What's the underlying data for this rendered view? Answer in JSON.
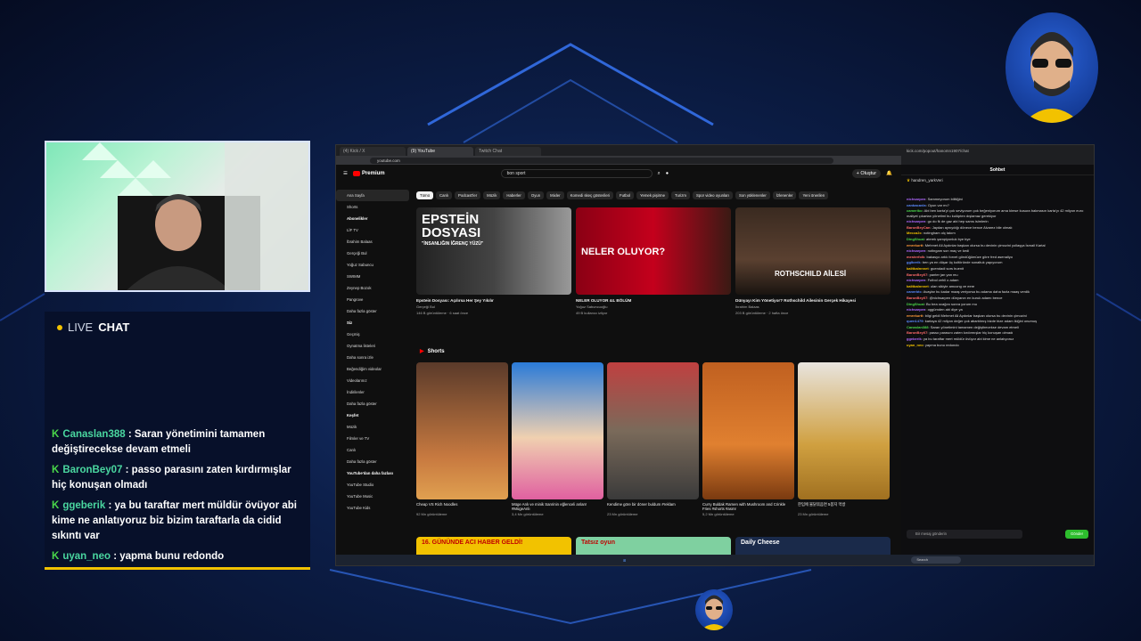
{
  "overlay": {
    "live_label": "LIVE",
    "chat_label": "CHAT",
    "messages": [
      {
        "user": "Canaslan388",
        "text": "Saran yönetimini tamamen değiştirecekse devam etmeli"
      },
      {
        "user": "BaronBey07",
        "text": "passo parasını zaten kırdırmışlar hiç konuşan olmadı"
      },
      {
        "user": "ggeberik",
        "text": "ya bu taraftar mert müldür övüyor abi kime ne anlatıyoruz biz bizim taraftarla da cidid sıkıntı var"
      },
      {
        "user": "uyan_neo",
        "text": "yapma bunu redondo"
      }
    ]
  },
  "browser": {
    "tabs": [
      "(4) Kick / X",
      "(9) YouTube",
      "Twitch Chat"
    ],
    "url": "youtube.com"
  },
  "youtube": {
    "logo": "Premium",
    "search": "bon sport",
    "create": "+ Oluştur",
    "sidebar": [
      "Ana Sayfa",
      "Shorts",
      "Abonelikler",
      "LİF TV",
      "İbrahim Balaas",
      "Gerçeği Bul",
      "Yoğuz Sabuncu",
      "SWIMM",
      "Zeynep Bozok",
      "Pangrove",
      "Daha fazla göster",
      "Siz",
      "Geçmiş",
      "Oynatma listeleri",
      "Daha sonra izle",
      "Beğendiğim videolar",
      "Videolarınız",
      "İndirilenler",
      "Daha fazla göster",
      "Keşfet",
      "Müzik",
      "Filmler ve TV",
      "Canlı",
      "Daha fazla göster",
      "YouTube'dan daha fazlası",
      "YouTube Studio",
      "YouTube Music",
      "YouTube Kids"
    ],
    "chips": [
      "Tümü",
      "Canlı",
      "Podcast'ler",
      "Müzik",
      "Haberler",
      "Oyun",
      "Mixler",
      "Komedi skeç gösterileri",
      "Futbol",
      "Yemek pişirme",
      "Turizm",
      "Spor video oyunları",
      "Son yüklenenler",
      "İzlenenler",
      "Yeni önerilen"
    ],
    "videos": [
      {
        "title": "Epstein Dosyası: Açılırsa Her Şey Yıkılır",
        "channel": "Gerçeği Bul",
        "meta": "146 B görüntüleme · 6 saat önce",
        "overlay1": "EPSTEİN",
        "overlay2": "DOSYASI",
        "overlay3": "\"İNSANLIĞIN İĞRENÇ YÜZÜ\""
      },
      {
        "title": "NELER OLUYOR 44. BÖLÜM",
        "channel": "Yoğuz Sabuncuoğlu",
        "meta": "49 B kullanıcı izliyor",
        "overlay1": "NELER OLUYOR?",
        "overlay2": "",
        "overlay3": ""
      },
      {
        "title": "Dünyayı Kim Yönetiyor? Rothschild Ailesinin Gerçek Hikayesi",
        "channel": "İbrahim Balaas",
        "meta": "203 B görüntüleme · 2 hafta önce",
        "overlay1": "ROTHSCHILD AİLESİ",
        "overlay2": "",
        "overlay3": ""
      }
    ],
    "shorts_label": "Shorts",
    "shorts": [
      {
        "title": "Cheap VS Rich Noodles",
        "views": "92 Mn görüntüleme"
      },
      {
        "title": "Müge Anlı ve minik Sanrinin eğlenceli anları! #MügeAnlı",
        "views": "3,4 Mn görüntüleme"
      },
      {
        "title": "Kendime göre bir döner buldum #reklam",
        "views": "23 Mn görüntüleme"
      },
      {
        "title": "Curry Buldak Ramen with Mushroom and Crinkle Fries #shorts #asmr",
        "views": "5,2 Mn görüntüleme"
      },
      {
        "title": "한입에 불닭볶음면 5봉지 먹방",
        "views": "23 Mn görüntüleme"
      }
    ],
    "bottom": [
      "16. GÜNÜNDE ACI HABER GELDİ!",
      "Tatsız oyun",
      "Daily Cheese"
    ]
  },
  "taskbar": {
    "search": "Search"
  },
  "twitch": {
    "url": "kick.com/popout/hanomn1907/chat",
    "heading": "Sohbet",
    "top_user": "handren_yarkVeri",
    "messages": [
      {
        "user": "nichsarpen",
        "text": "Sammeyorum bilitiğini"
      },
      {
        "user": "canbacavla",
        "text": "Oyun var mı?"
      },
      {
        "user": "cameriko",
        "text": "Abi ben karta'yi çok seviyorum çok beğeniyorum ama kimse kusura bakmasın karta'yı 42 milyon euro maliyet çıkartan yönetimi bu kulüpten dışlamaz gerekiyor"
      },
      {
        "user": "nichsarpen",
        "text": "go do fk de gaz abi hep sams isimlerin"
      },
      {
        "user": "BaronBeyCan",
        "text": "Jaydan aynıydığı dönece bence Alvarez bile olmalı"
      },
      {
        "user": "Mecca2c",
        "text": "notingham olç takım"
      },
      {
        "user": "DingShuai",
        "text": "aterek şampiyonluk bye bye"
      },
      {
        "user": "emrekurtt",
        "text": "Mehmet Ali Aydınlar başkan olursa bu devinin çimozini yollaşya İsmail Kartal"
      },
      {
        "user": "nichsarpen",
        "text": "notingam son maç ve kedi"
      },
      {
        "user": "mesterfolk",
        "text": "bakasyo artık forvet göndüğümüze göre fred asenaliyo"
      },
      {
        "user": "gglberik",
        "text": "ben ya en düşar üç koltöründe sonaltuk yapıyorum"
      },
      {
        "user": "kalitbalnnnet",
        "text": "guendadi sors buenit"
      },
      {
        "user": "BaronBey07",
        "text": "panter jan yan mu"
      },
      {
        "user": "nichsarpen",
        "text": "Futbol zehli o adam"
      },
      {
        "user": "kalitbalnnnet",
        "text": "ulan sikiyle amcong ve eere"
      },
      {
        "user": "canerbtc",
        "text": "Avaylar bu kadar maaş veriyorsa bu adama daha fazla maaş verdik"
      },
      {
        "user": "BaronBey07",
        "text": "@nichsarpen dünyanın en kuruk adamı bence"
      },
      {
        "user": "DingShuai",
        "text": "Bu bea ocağını sonra yorum mu"
      },
      {
        "user": "nichsarpen",
        "text": "oggümden abi diye ya"
      },
      {
        "user": "emrekurtt",
        "text": "bilgi geldi Mehmet Ali Aydınlar başkan olursa bu devinin çimozini"
      },
      {
        "user": "quen1479",
        "text": "kartaya 42 milyon değer çok abartılmış bizde bize adam ikiğini onumuş"
      },
      {
        "user": "Canaslan388",
        "text": "Saran yönetimini tamamen değiştirecekse devam etmeli"
      },
      {
        "user": "BaronBey07",
        "text": "passo parasını zaten kırdırmışlar hiç konuşan olmadı"
      },
      {
        "user": "ggeberik",
        "text": "ya bu taraftar mert müldür övüyor abi kime ne anlatıyoruz"
      },
      {
        "user": "uyan_neo",
        "text": "yapma bunu redondo"
      }
    ],
    "input_placeholder": "Bir mesaj gönderin",
    "send": "Gönder"
  }
}
